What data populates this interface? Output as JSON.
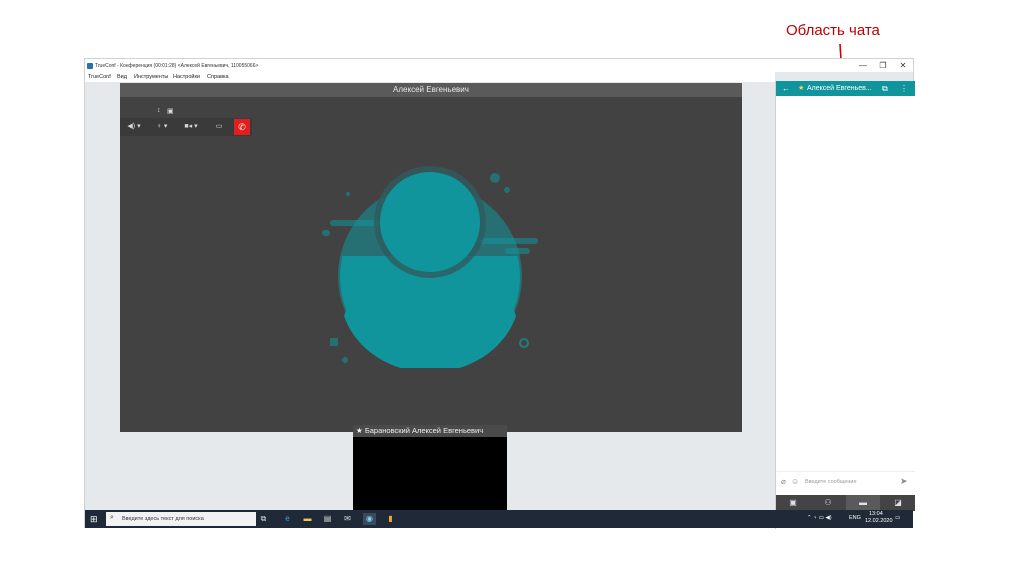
{
  "annotation": {
    "label": "Область чата",
    "color": "#c00000"
  },
  "window": {
    "title": "TrueConf - Конференция (00:01:28) <Алексей Евгеньевич, 110055066>",
    "controls": {
      "minimize": "—",
      "restore": "❐",
      "close": "✕"
    }
  },
  "menu": [
    "TrueConf",
    "Вид",
    "Инструменты",
    "Настройки",
    "Справка"
  ],
  "video": {
    "participant_name": "Алексей Евгеньевич",
    "background_color": "#424242",
    "avatar_color": "#11959c"
  },
  "self_view": {
    "star": "★",
    "name": "Барановский Алексей Евгеньевич"
  },
  "toolbar": {
    "speaker_icon": "speaker-icon",
    "mic_icon": "microphone-icon",
    "camera_icon": "camera-icon",
    "share_icon": "screen-share-icon",
    "end_call_icon": "hang-up-icon",
    "end_call_color": "#e02020"
  },
  "chat": {
    "header_color": "#11959c",
    "back": "←",
    "star": "★",
    "contact_name": "Алексей Евгеньев...",
    "popout": "⧉",
    "more": "⋮",
    "input_placeholder": "Введите сообщение",
    "send": "➤",
    "tabs": [
      "participants-icon",
      "contacts-icon",
      "chat-icon",
      "settings-icon"
    ]
  },
  "taskbar": {
    "search_placeholder": "Введите здесь текст для поиска",
    "lang": "ENG",
    "time": "13:04",
    "date": "12.02.2020"
  }
}
